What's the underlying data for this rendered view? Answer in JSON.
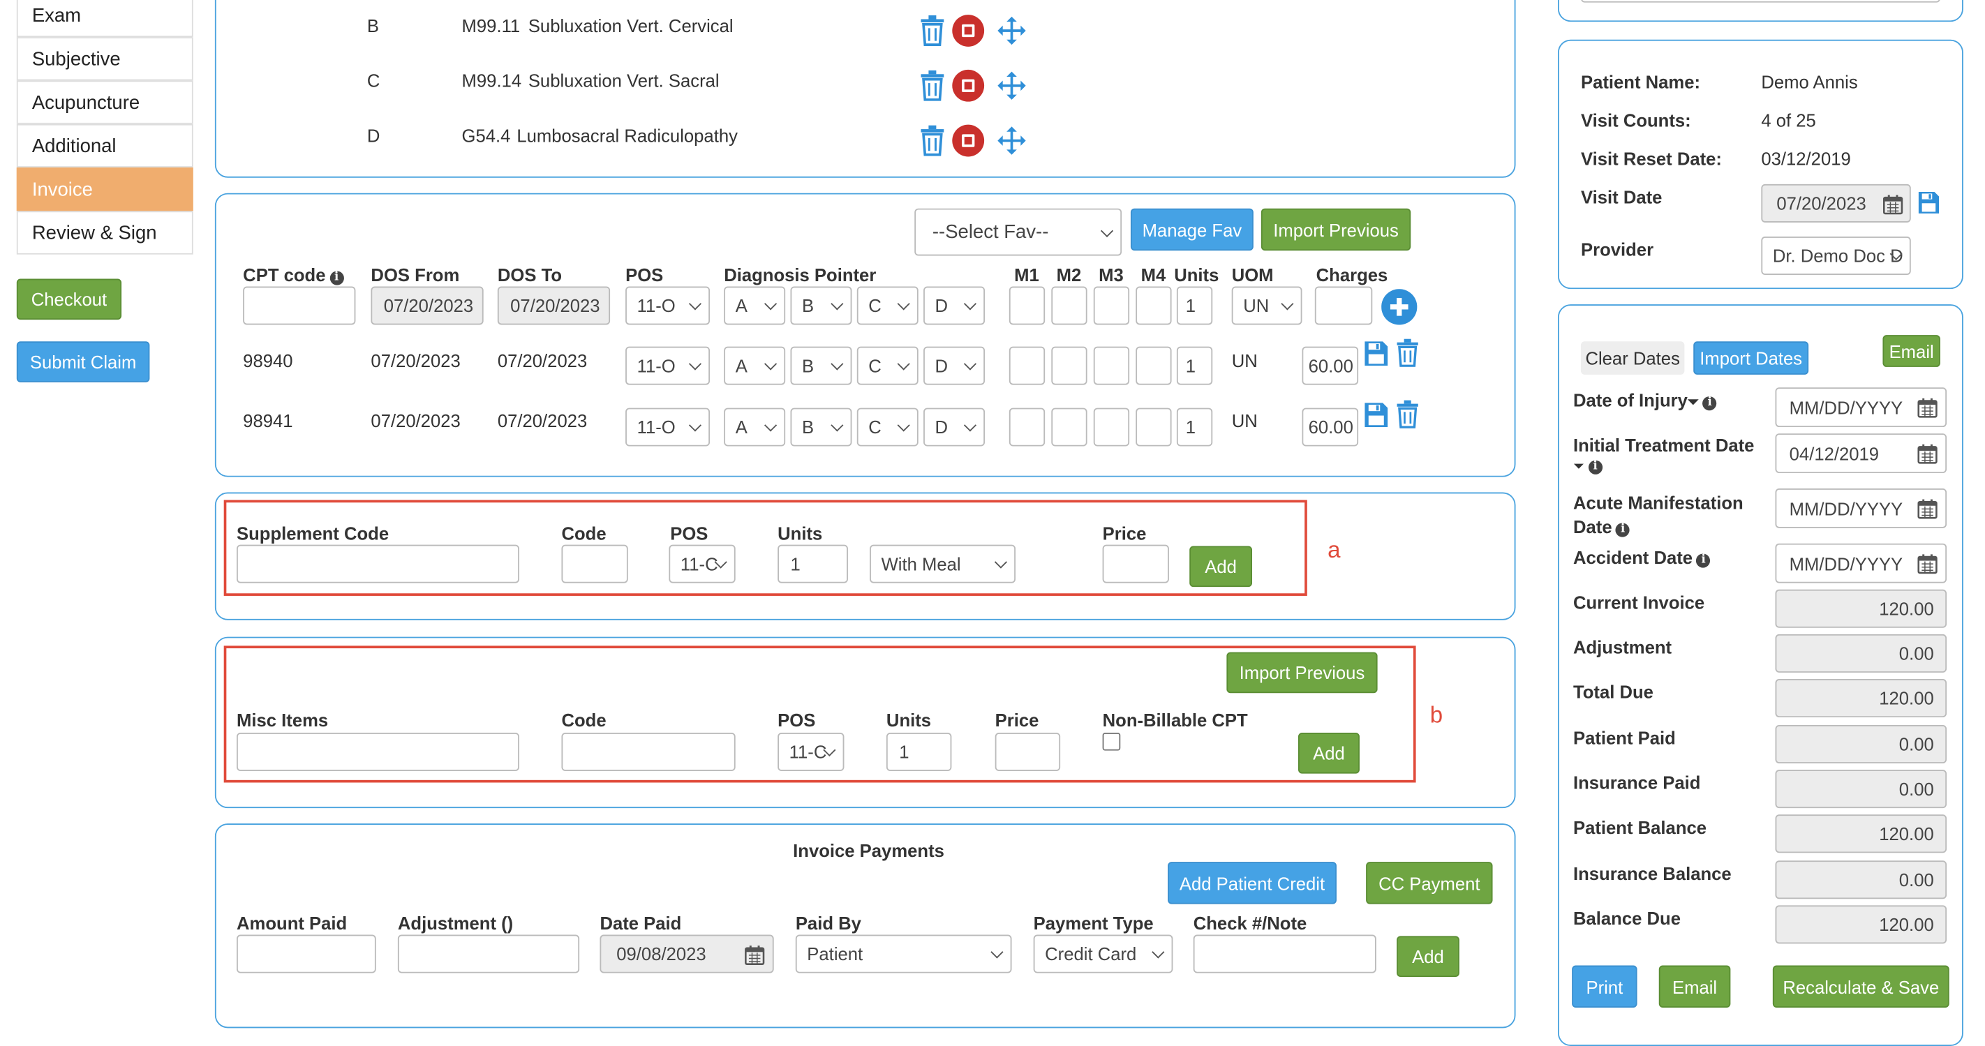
{
  "sidebar": {
    "items": [
      {
        "label": "Exam"
      },
      {
        "label": "Subjective"
      },
      {
        "label": "Acupuncture"
      },
      {
        "label": "Additional"
      },
      {
        "label": "Invoice"
      },
      {
        "label": "Review & Sign"
      }
    ],
    "checkout_label": "Checkout",
    "submit_claim_label": "Submit Claim"
  },
  "diagnoses": [
    {
      "letter": "B",
      "code": "M99.11",
      "desc": "Subluxation Vert. Cervical"
    },
    {
      "letter": "C",
      "code": "M99.14",
      "desc": "Subluxation Vert. Sacral"
    },
    {
      "letter": "D",
      "code": "G54.4",
      "desc": "Lumbosacral Radiculopathy"
    }
  ],
  "cpt": {
    "select_fav": "--Select Fav--",
    "manage_fav": "Manage Fav",
    "import_previous": "Import Previous",
    "headers": {
      "cpt": "CPT code",
      "dos_from": "DOS From",
      "dos_to": "DOS To",
      "pos": "POS",
      "diag": "Diagnosis Pointer",
      "m1": "M1",
      "m2": "M2",
      "m3": "M3",
      "m4": "M4",
      "units": "Units",
      "uom": "UOM",
      "charges": "Charges"
    },
    "new_row": {
      "dos_from": "07/20/2023",
      "dos_to": "07/20/2023",
      "pos": "11-O",
      "p1": "A",
      "p2": "B",
      "p3": "C",
      "p4": "D",
      "units": "1",
      "uom": "UN"
    },
    "rows": [
      {
        "code": "98940",
        "dos_from": "07/20/2023",
        "dos_to": "07/20/2023",
        "pos": "11-O",
        "p1": "A",
        "p2": "B",
        "p3": "C",
        "p4": "D",
        "units": "1",
        "uom": "UN",
        "charges": "60.00"
      },
      {
        "code": "98941",
        "dos_from": "07/20/2023",
        "dos_to": "07/20/2023",
        "pos": "11-O",
        "p1": "A",
        "p2": "B",
        "p3": "C",
        "p4": "D",
        "units": "1",
        "uom": "UN",
        "charges": "60.00"
      }
    ]
  },
  "supplement": {
    "label": "Supplement Code",
    "code": "Code",
    "pos": "POS",
    "units": "Units",
    "price": "Price",
    "pos_value": "11-C",
    "units_value": "1",
    "meal": "With Meal",
    "add": "Add",
    "annotation": "a"
  },
  "misc": {
    "import_previous": "Import Previous",
    "label": "Misc Items",
    "code": "Code",
    "pos": "POS",
    "units": "Units",
    "price": "Price",
    "non_billable": "Non-Billable CPT",
    "pos_value": "11-C",
    "units_value": "1",
    "add": "Add",
    "annotation": "b"
  },
  "payments": {
    "title": "Invoice Payments",
    "add_credit": "Add Patient Credit",
    "cc_payment": "CC Payment",
    "amount_paid": "Amount Paid",
    "adjustment": "Adjustment ()",
    "date_paid": "Date Paid",
    "paid_by": "Paid By",
    "payment_type": "Payment Type",
    "check_note": "Check #/Note",
    "date_paid_value": "09/08/2023",
    "paid_by_value": "Patient",
    "payment_type_value": "Credit Card",
    "add": "Add"
  },
  "patient": {
    "name_label": "Patient Name:",
    "name": "Demo Annis",
    "visit_counts_label": "Visit Counts:",
    "visit_counts": "4 of 25",
    "reset_label": "Visit Reset Date:",
    "reset_date": "03/12/2019",
    "visit_date_label": "Visit Date",
    "visit_date": "07/20/2023",
    "provider_label": "Provider",
    "provider": "Dr. Demo Doc D"
  },
  "summary": {
    "clear_dates": "Clear Dates",
    "import_dates": "Import Dates",
    "email_top": "Email",
    "injury_label": "Date of Injury",
    "injury": "MM/DD/YYYY",
    "initial_label": "Initial Treatment Date",
    "initial": "04/12/2019",
    "acute_label": "Acute Manifestation Date",
    "acute": "MM/DD/YYYY",
    "accident_label": "Accident Date",
    "accident": "MM/DD/YYYY",
    "rows": [
      {
        "label": "Current Invoice",
        "value": "120.00"
      },
      {
        "label": "Adjustment",
        "value": "0.00"
      },
      {
        "label": "Total Due",
        "value": "120.00"
      },
      {
        "label": "Patient Paid",
        "value": "0.00"
      },
      {
        "label": "Insurance Paid",
        "value": "0.00"
      },
      {
        "label": "Patient Balance",
        "value": "120.00"
      },
      {
        "label": "Insurance Balance",
        "value": "0.00"
      },
      {
        "label": "Balance Due",
        "value": "120.00"
      }
    ],
    "print": "Print",
    "email_bottom": "Email",
    "recalculate": "Recalculate & Save"
  },
  "colors": {
    "accent_blue": "#45a2e5",
    "accent_green": "#6fa542",
    "active_nav": "#f0ad6e",
    "annotation_red": "#e04a3a",
    "panel_border": "#4aa3df"
  }
}
